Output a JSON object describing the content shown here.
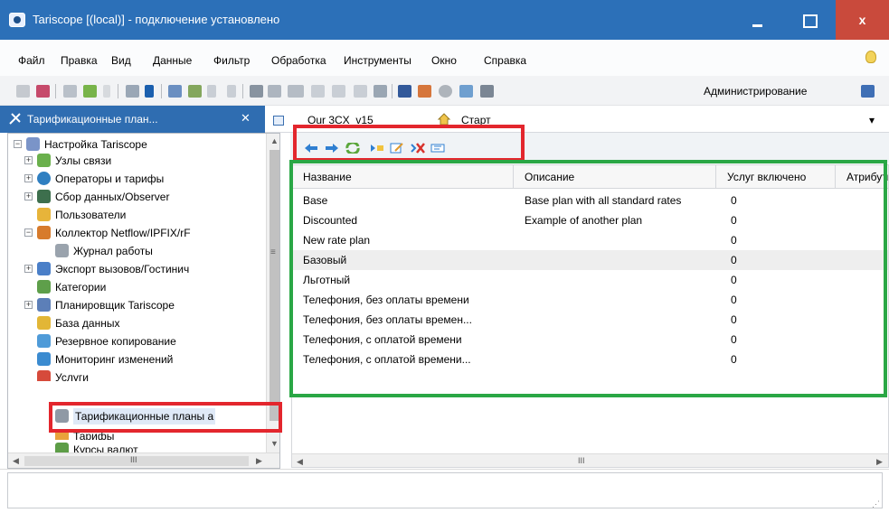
{
  "window": {
    "title": "Tariscope [(local)] - подключение установлено",
    "close_glyph": "x"
  },
  "menu": [
    "Файл",
    "Правка",
    "Вид",
    "Данные",
    "Фильтр",
    "Обработка",
    "Инструменты",
    "Окно",
    "Справка"
  ],
  "toolbar": {
    "administration_label": "Администрирование"
  },
  "tabs": [
    {
      "label": "Тарификационные план...",
      "close": "✕",
      "icon": "gear-tools-icon"
    },
    {
      "label": "Our 3CX_v15",
      "icon": "table-icon"
    },
    {
      "label": "Старт",
      "icon": "home-icon"
    }
  ],
  "tab_overflow_glyph": "▾",
  "tree": {
    "items": [
      {
        "label": "Настройка Tariscope",
        "expander": "−",
        "icon": "settings-icon",
        "color": "#7a94c8"
      },
      {
        "label": "Узлы связи",
        "expander": "+",
        "icon": "nodes-icon",
        "color": "#6ab04c"
      },
      {
        "label": "Операторы и тарифы",
        "expander": "+",
        "icon": "globe-icon",
        "color": "#2f7fc1"
      },
      {
        "label": "Сбор данных/Observer",
        "expander": "+",
        "icon": "observer-icon",
        "color": "#3d6f4d"
      },
      {
        "label": "Пользователи",
        "expander": "",
        "icon": "key-icon",
        "color": "#e7b43a"
      },
      {
        "label": "Коллектор Netflow/IPFIX/rF",
        "expander": "−",
        "icon": "network-icon",
        "color": "#d77b2c"
      },
      {
        "label": "Журнал работы",
        "expander": "",
        "icon": "log-icon",
        "color": "#9aa3ad"
      },
      {
        "label": "Экспорт вызовов/Гостинич",
        "expander": "+",
        "icon": "export-icon",
        "color": "#4a7fc8"
      },
      {
        "label": "Категории",
        "expander": "",
        "icon": "categories-icon",
        "color": "#5e9f4a"
      },
      {
        "label": "Планировщик Tariscope",
        "expander": "+",
        "icon": "scheduler-icon",
        "color": "#5c7fb8"
      },
      {
        "label": "База данных",
        "expander": "",
        "icon": "database-icon",
        "color": "#e2b636"
      },
      {
        "label": "Резервное копирование",
        "expander": "",
        "icon": "backup-icon",
        "color": "#4f9bd8"
      },
      {
        "label": "Мониторинг изменений",
        "expander": "",
        "icon": "monitoring-icon",
        "color": "#3b8bd0"
      },
      {
        "label": "Услуги",
        "expander": "",
        "icon": "services-icon",
        "color": "#d64a3b"
      },
      {
        "label": "Тарификационные планы а",
        "expander": "",
        "icon": "rate-plans-icon",
        "color": "#8f99a5",
        "selected": true
      },
      {
        "label": "Тарифы",
        "expander": "",
        "icon": "tariffs-icon",
        "color": "#e9a23b"
      },
      {
        "label": "Курсы валют",
        "expander": "",
        "icon": "currency-icon",
        "color": "#5d9d47"
      }
    ],
    "scroll_grip": "≡",
    "hscroll_grip": "III"
  },
  "grid": {
    "columns": [
      "Название",
      "Описание",
      "Услуг включено",
      "Атрибуты"
    ],
    "rows": [
      {
        "name": "Base",
        "description": "Base plan with all standard rates",
        "services": "0"
      },
      {
        "name": "Discounted",
        "description": "Example of another plan",
        "services": "0"
      },
      {
        "name": "New rate plan",
        "description": "",
        "services": "0"
      },
      {
        "name": "Базовый",
        "description": "",
        "services": "0",
        "highlight": true
      },
      {
        "name": "Льготный",
        "description": "",
        "services": "0"
      },
      {
        "name": "Телефония, без оплаты времени",
        "description": "",
        "services": "0"
      },
      {
        "name": "Телефония, без оплаты времен...",
        "description": "",
        "services": "0"
      },
      {
        "name": "Телефония, с оплатой времени",
        "description": "",
        "services": "0"
      },
      {
        "name": "Телефония, с оплатой времени...",
        "description": "",
        "services": "0"
      }
    ],
    "hscroll_grip": "III"
  },
  "scroll_arrows": {
    "up": "▲",
    "down": "▼",
    "left": "◀",
    "right": "▶"
  },
  "status": {
    "sizegrip": "⋰"
  },
  "colors": {
    "titlebar": "#2c70b8",
    "active_tab": "#2f6db1",
    "annotation_red": "#e3262d",
    "annotation_green": "#2aa745"
  }
}
